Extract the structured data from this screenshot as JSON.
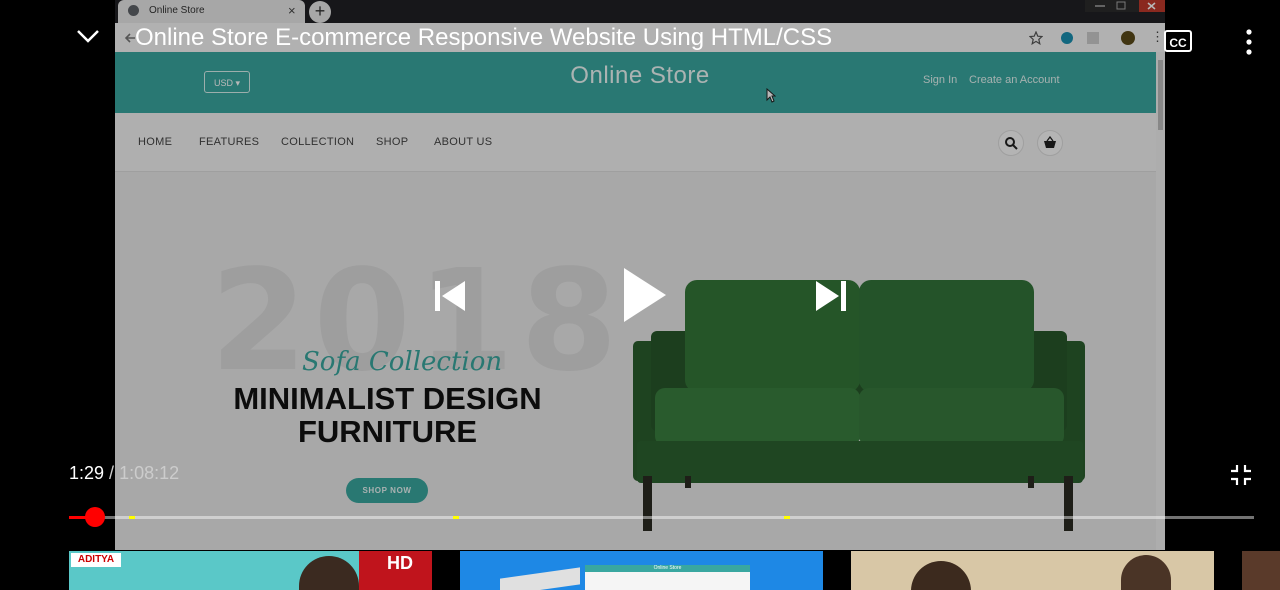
{
  "browser": {
    "tab_title": "Online Store",
    "tab_close": "×",
    "new_tab": "+"
  },
  "site": {
    "currency": "USD ▾",
    "logo": "Online Store",
    "sign_in": "Sign In",
    "create_account": "Create an Account",
    "nav": [
      "HOME",
      "FEATURES",
      "COLLECTION",
      "SHOP",
      "ABOUT US"
    ],
    "hero": {
      "year": "2018",
      "script": "Sofa Collection",
      "headline_1": "MINIMALIST DESIGN",
      "headline_2": "FURNITURE",
      "cta": "SHOP NOW"
    },
    "colors": {
      "accent": "#39a7a0",
      "sofa": "#2e6a32"
    }
  },
  "player": {
    "title": "Online Store E-commerce Responsive Website Using HTML/CSS",
    "cc_label": "CC",
    "current_time": "1:29",
    "separator": " / ",
    "duration": "1:08:12",
    "progress_fraction": 0.0218,
    "progress_color": "#ff0000"
  },
  "related": {
    "card1_badge": "ADITYA",
    "card1_hd": "HD",
    "card2_title": "Online Store"
  }
}
